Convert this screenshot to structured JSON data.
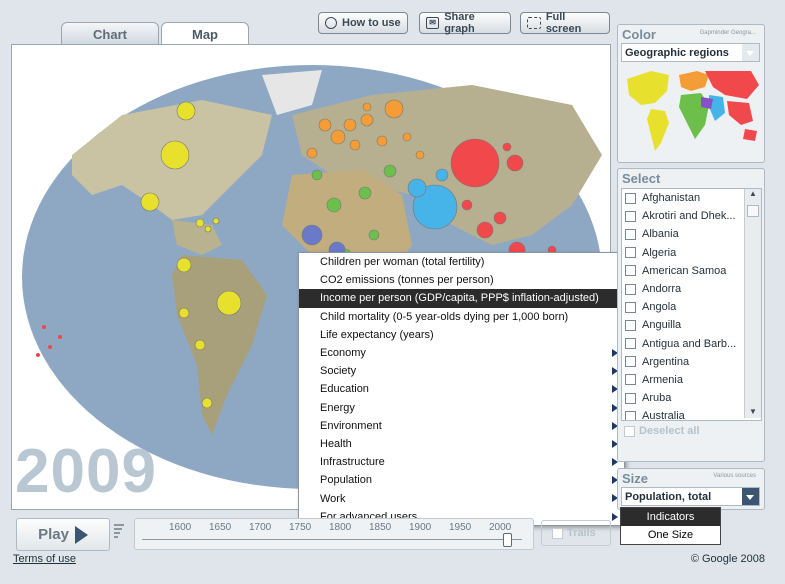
{
  "tabs": [
    {
      "label": "Chart"
    },
    {
      "label": "Map"
    }
  ],
  "toolbar": {
    "how_to_use": "How to use",
    "share_graph": "Share graph",
    "full_screen": "Full screen"
  },
  "year": "2009",
  "context_menu": {
    "items": [
      {
        "label": "Children per woman (total fertility)",
        "submenu": false
      },
      {
        "label": "CO2 emissions (tonnes per person)",
        "submenu": false
      },
      {
        "label": "Income per person (GDP/capita, PPP$ inflation-adjusted)",
        "submenu": false,
        "highlighted": true
      },
      {
        "label": "Child mortality (0-5 year-olds dying per 1,000 born)",
        "submenu": false
      },
      {
        "label": "Life expectancy (years)",
        "submenu": false
      },
      {
        "label": "Economy",
        "submenu": true
      },
      {
        "label": "Society",
        "submenu": true
      },
      {
        "label": "Education",
        "submenu": true
      },
      {
        "label": "Energy",
        "submenu": true
      },
      {
        "label": "Environment",
        "submenu": true
      },
      {
        "label": "Health",
        "submenu": true
      },
      {
        "label": "Infrastructure",
        "submenu": true
      },
      {
        "label": "Population",
        "submenu": true
      },
      {
        "label": "Work",
        "submenu": true
      },
      {
        "label": "For advanced users",
        "submenu": true
      }
    ]
  },
  "color_panel": {
    "title": "Color",
    "note": "Gapminder Geogra...",
    "selected": "Geographic regions"
  },
  "select_panel": {
    "title": "Select",
    "countries": [
      "Afghanistan",
      "Akrotiri and Dhek...",
      "Albania",
      "Algeria",
      "American Samoa",
      "Andorra",
      "Angola",
      "Anguilla",
      "Antigua and Barb...",
      "Argentina",
      "Armenia",
      "Aruba",
      "Australia"
    ],
    "deselect_all": "Deselect all"
  },
  "size_panel": {
    "title": "Size",
    "note": "Various sources",
    "selected": "Population, total"
  },
  "size_popup": {
    "items": [
      "Indicators",
      "One Size"
    ]
  },
  "timeline": {
    "play_label": "Play",
    "ticks": [
      "1600",
      "1650",
      "1700",
      "1750",
      "1800",
      "1850",
      "1900",
      "1950",
      "2000"
    ],
    "trails_label": "Trails"
  },
  "footer": {
    "terms": "Terms of use",
    "copyright": "© Google 2008"
  },
  "colors": {
    "americas": "#e7e02c",
    "europe": "#f49d37",
    "africa": "#6cbf4b",
    "asia_south": "#46b4e8",
    "asia_east": "#f0484b",
    "ocean": "#8fa9c6"
  }
}
